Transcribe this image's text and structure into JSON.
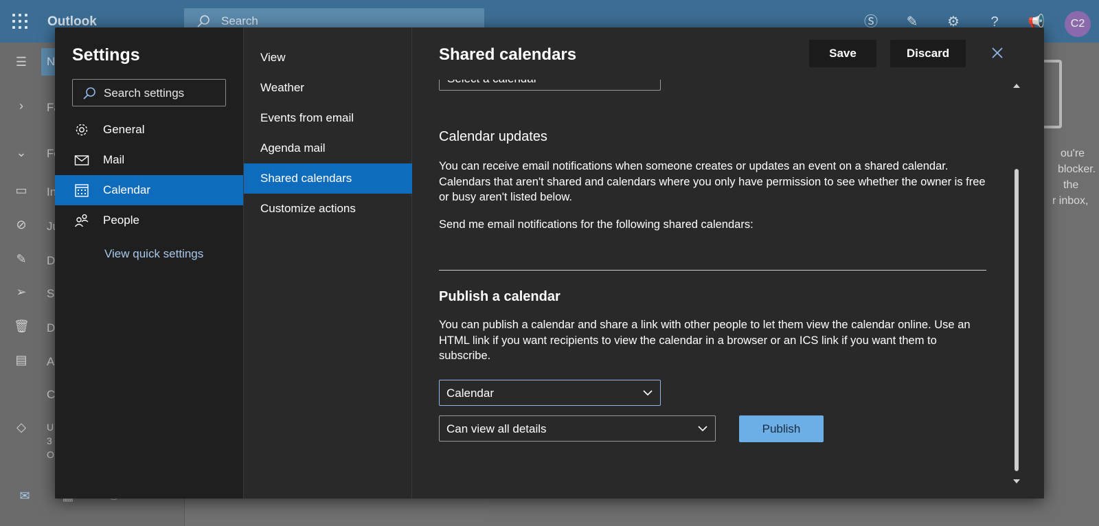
{
  "app": {
    "brand": "Outlook",
    "search_placeholder": "Search",
    "avatar_initials": "C2"
  },
  "background": {
    "rail_fragments": [
      "N",
      "Fa",
      "Fo",
      "In",
      "Ju",
      "D",
      "Se",
      "D",
      "A",
      "C",
      "U",
      "3",
      "O"
    ],
    "right_fragments": [
      "ou're",
      "blocker.",
      "the",
      "r inbox,"
    ]
  },
  "settings": {
    "title": "Settings",
    "search_placeholder": "Search settings",
    "categories": [
      {
        "label": "General",
        "icon": "gear-icon",
        "active": false
      },
      {
        "label": "Mail",
        "icon": "mail-icon",
        "active": false
      },
      {
        "label": "Calendar",
        "icon": "calendar-icon",
        "active": true
      },
      {
        "label": "People",
        "icon": "people-icon",
        "active": false
      }
    ],
    "quick_settings_link": "View quick settings",
    "subcategories": [
      {
        "label": "View",
        "active": false
      },
      {
        "label": "Weather",
        "active": false
      },
      {
        "label": "Events from email",
        "active": false
      },
      {
        "label": "Agenda mail",
        "active": false
      },
      {
        "label": "Shared calendars",
        "active": true
      },
      {
        "label": "Customize actions",
        "active": false
      }
    ]
  },
  "pane": {
    "title": "Shared calendars",
    "save_label": "Save",
    "discard_label": "Discard",
    "partial_select": "Select a calendar",
    "updates_heading": "Calendar updates",
    "updates_text": "You can receive email notifications when someone creates or updates an event on a shared calendar. Calendars that aren't shared and calendars where you only have permission to see whether the owner is free or busy aren't listed below.",
    "notify_text": "Send me email notifications for the following shared calendars:",
    "publish_heading": "Publish a calendar",
    "publish_text": "You can publish a calendar and share a link with other people to let them view the calendar online. Use an HTML link if you want recipients to view the calendar in a browser or an ICS link if you want them to subscribe.",
    "calendar_select": "Calendar",
    "permission_select": "Can view all details",
    "publish_label": "Publish"
  }
}
